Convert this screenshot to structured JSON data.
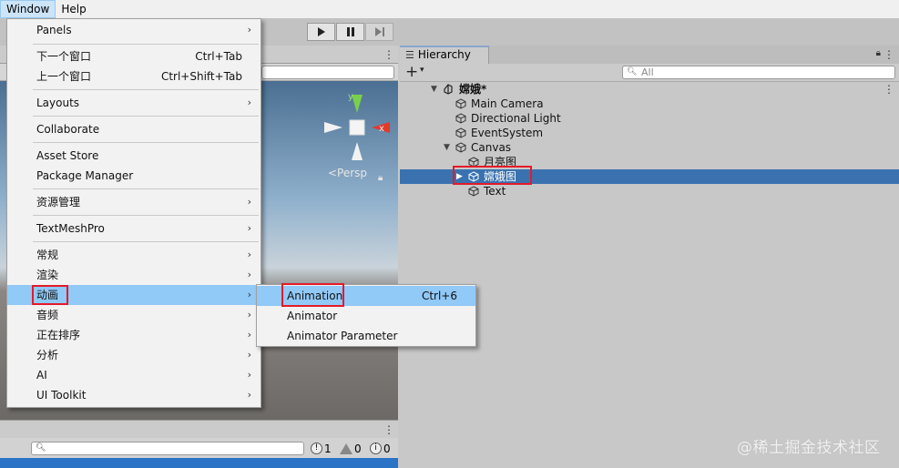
{
  "menubar": {
    "window": "Window",
    "help": "Help"
  },
  "window_menu": {
    "items": [
      {
        "label": "Panels",
        "shortcut": "",
        "submenu": true
      },
      {
        "label": "下一个窗口",
        "shortcut": "Ctrl+Tab",
        "submenu": false
      },
      {
        "label": "上一个窗口",
        "shortcut": "Ctrl+Shift+Tab",
        "submenu": false
      },
      {
        "label": "Layouts",
        "shortcut": "",
        "submenu": true
      },
      {
        "label": "Collaborate",
        "shortcut": "",
        "submenu": false
      },
      {
        "label": "Asset Store",
        "shortcut": "",
        "submenu": false
      },
      {
        "label": "Package Manager",
        "shortcut": "",
        "submenu": false
      },
      {
        "label": "资源管理",
        "shortcut": "",
        "submenu": true
      },
      {
        "label": "TextMeshPro",
        "shortcut": "",
        "submenu": true
      },
      {
        "label": "常规",
        "shortcut": "",
        "submenu": true
      },
      {
        "label": "渲染",
        "shortcut": "",
        "submenu": true
      },
      {
        "label": "动画",
        "shortcut": "",
        "submenu": true
      },
      {
        "label": "音频",
        "shortcut": "",
        "submenu": true
      },
      {
        "label": "正在排序",
        "shortcut": "",
        "submenu": true
      },
      {
        "label": "分析",
        "shortcut": "",
        "submenu": true
      },
      {
        "label": "AI",
        "shortcut": "",
        "submenu": true
      },
      {
        "label": "UI Toolkit",
        "shortcut": "",
        "submenu": true
      }
    ],
    "submenu_arrow": "›"
  },
  "animation_submenu": {
    "items": [
      {
        "label": "Animation",
        "shortcut": "Ctrl+6"
      },
      {
        "label": "Animator",
        "shortcut": ""
      },
      {
        "label": "Animator Parameter",
        "shortcut": ""
      }
    ]
  },
  "scene": {
    "persp_label": "<Persp",
    "axis_y": "y",
    "axis_x": "x"
  },
  "console": {
    "errors": "1",
    "warnings": "0",
    "messages": "0"
  },
  "hierarchy": {
    "tab_label": "Hierarchy",
    "search_placeholder": "All",
    "scene_name": "嫦娥*",
    "objects": [
      {
        "label": "Main Camera"
      },
      {
        "label": "Directional Light"
      },
      {
        "label": "EventSystem"
      },
      {
        "label": "Canvas"
      },
      {
        "label": "月亮图"
      },
      {
        "label": "嫦娥图"
      },
      {
        "label": "Text"
      }
    ]
  },
  "watermark": "@稀土掘金技术社区",
  "colors": {
    "menu_highlight": "#91c9f7",
    "selection": "#3a72b0",
    "annotation_red": "#e21b2b"
  }
}
